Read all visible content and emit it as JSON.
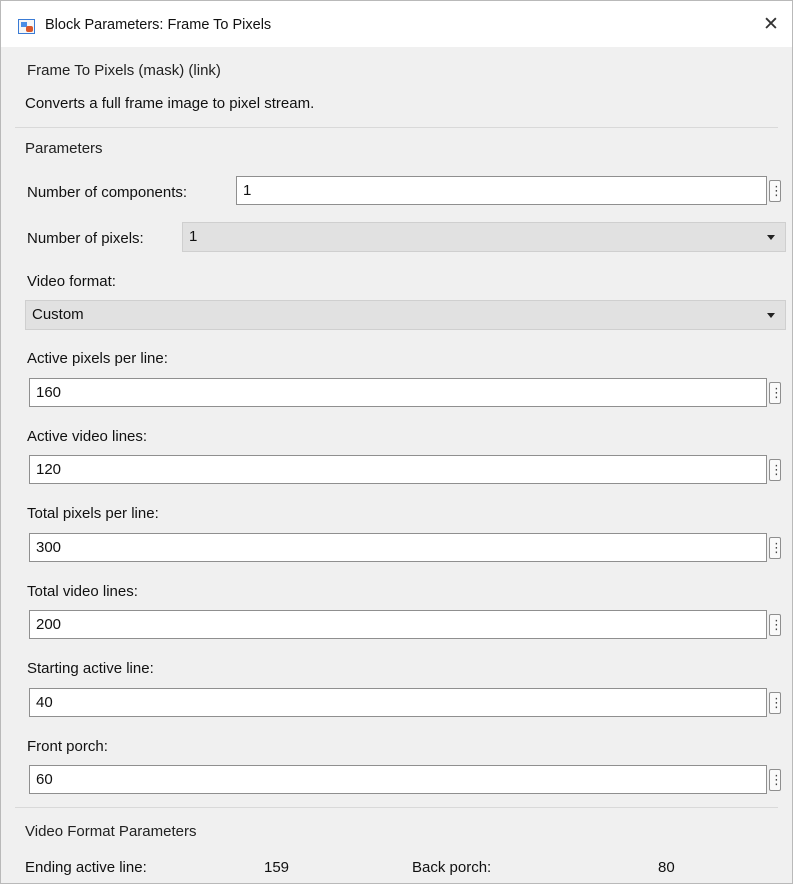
{
  "window": {
    "title": "Block Parameters: Frame To Pixels",
    "close_glyph": "✕"
  },
  "mask": {
    "name": "Frame To Pixels (mask) (link)",
    "description": "Converts a full frame image to pixel stream."
  },
  "parameters": {
    "group_title": "Parameters",
    "num_components": {
      "label": "Number of components:",
      "value": "1"
    },
    "num_pixels": {
      "label": "Number of pixels:",
      "selected": "1"
    },
    "video_format": {
      "label": "Video format:",
      "selected": "Custom"
    },
    "active_pixels_per_line": {
      "label": "Active pixels per line:",
      "value": "160"
    },
    "active_video_lines": {
      "label": "Active video lines:",
      "value": "120"
    },
    "total_pixels_per_line": {
      "label": "Total pixels per line:",
      "value": "300"
    },
    "total_video_lines": {
      "label": "Total video lines:",
      "value": "200"
    },
    "starting_active_line": {
      "label": "Starting active line:",
      "value": "40"
    },
    "front_porch": {
      "label": "Front porch:",
      "value": "60"
    },
    "more_options_glyph": "⋮"
  },
  "video_format_parameters": {
    "group_title": "Video Format Parameters",
    "ending_active_line": {
      "label": "Ending active line:",
      "value": "159"
    },
    "back_porch": {
      "label": "Back porch:",
      "value": "80"
    }
  },
  "icons": {
    "app": "simulink-block-icon",
    "close": "close-icon",
    "more": "vertical-ellipsis-icon",
    "dropdown": "chevron-down-icon"
  }
}
